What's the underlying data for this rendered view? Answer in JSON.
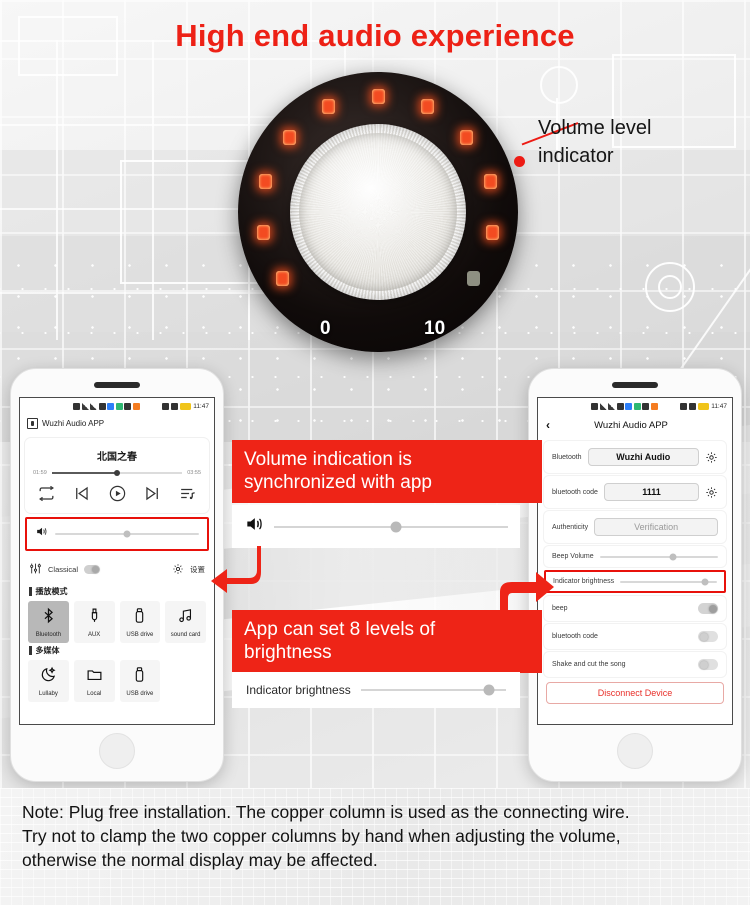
{
  "title": "High end audio experience",
  "knob": {
    "min_label": "0",
    "max_label": "10",
    "led_count": 11,
    "lit_count": 10,
    "colors": {
      "led_on": "#f34b21",
      "led_off": "#8e9082",
      "ring": "#100b0a"
    }
  },
  "callout": {
    "label_line1": "Volume level",
    "label_line2": "indicator",
    "color": "#ed1b14"
  },
  "banners": [
    {
      "name": "volume-sync",
      "line1": "Volume indication is",
      "line2": "synchronized with app",
      "color": "#ee2417"
    },
    {
      "name": "brightness-levels",
      "line1": "App can set 8 levels of",
      "line2": "brightness",
      "color": "#ee2417"
    }
  ],
  "mini_volume": {
    "icon": "speaker-icon",
    "value_pct": 52
  },
  "mini_brightness": {
    "label": "Indicator brightness",
    "value_pct": 88
  },
  "left_phone": {
    "statusbar": {
      "time": "11:47"
    },
    "appbar": {
      "title": "Wuzhi Audio APP",
      "icon": "app-icon"
    },
    "player": {
      "song_title": "北国之春",
      "elapsed": "01:59",
      "duration": "03:55",
      "progress_pct": 50,
      "controls": [
        "repeat-icon",
        "previous-icon",
        "play-icon",
        "next-icon",
        "playlist-icon"
      ]
    },
    "volume": {
      "icon": "speaker-icon",
      "value_pct": 50
    },
    "eq": {
      "label": "Classical",
      "toggle_on": true,
      "settings_label": "设置",
      "settings_icon": "gear-icon"
    },
    "sections": [
      {
        "heading": "播放模式",
        "tiles": [
          {
            "label": "Bluetooth",
            "icon": "bluetooth-icon",
            "selected": true
          },
          {
            "label": "AUX",
            "icon": "aux-icon",
            "selected": false
          },
          {
            "label": "USB drive",
            "icon": "usb-icon",
            "selected": false
          },
          {
            "label": "sound card",
            "icon": "music-note-icon",
            "selected": false
          }
        ]
      },
      {
        "heading": "多媒体",
        "tiles": [
          {
            "label": "Lullaby",
            "icon": "moon-icon",
            "selected": false
          },
          {
            "label": "Local",
            "icon": "folder-icon",
            "selected": false
          },
          {
            "label": "USB drive",
            "icon": "usb-icon",
            "selected": false
          }
        ]
      }
    ]
  },
  "right_phone": {
    "statusbar": {
      "time": "11:47"
    },
    "navbar": {
      "back_icon": "chevron-left-icon",
      "title": "Wuzhi Audio APP"
    },
    "rows": [
      {
        "label": "Bluetooth",
        "value": "Wuzhi Audio",
        "type": "pill",
        "gear": true,
        "muted": false
      },
      {
        "label": "bluetooth code",
        "value": "1111",
        "type": "pill",
        "gear": true,
        "muted": false
      },
      {
        "label": "Authenticity",
        "value": "Verification",
        "type": "pill",
        "gear": false,
        "muted": true
      },
      {
        "label": "Beep Volume",
        "type": "slider",
        "value_pct": 62
      },
      {
        "label": "Indicator brightness",
        "type": "slider",
        "value_pct": 88,
        "highlighted": true
      },
      {
        "label": "beep",
        "type": "toggle",
        "on": true
      },
      {
        "label": "bluetooth code",
        "type": "toggle",
        "on": false
      },
      {
        "label": "Shake and cut the song",
        "type": "toggle",
        "on": false
      }
    ],
    "disconnect_label": "Disconnect Device"
  },
  "note": {
    "line1": "Note: Plug free installation. The copper column is used as the connecting wire.",
    "line2": "Try not to clamp the two copper columns by hand when adjusting the volume,",
    "line3": "otherwise the normal display may be affected."
  }
}
